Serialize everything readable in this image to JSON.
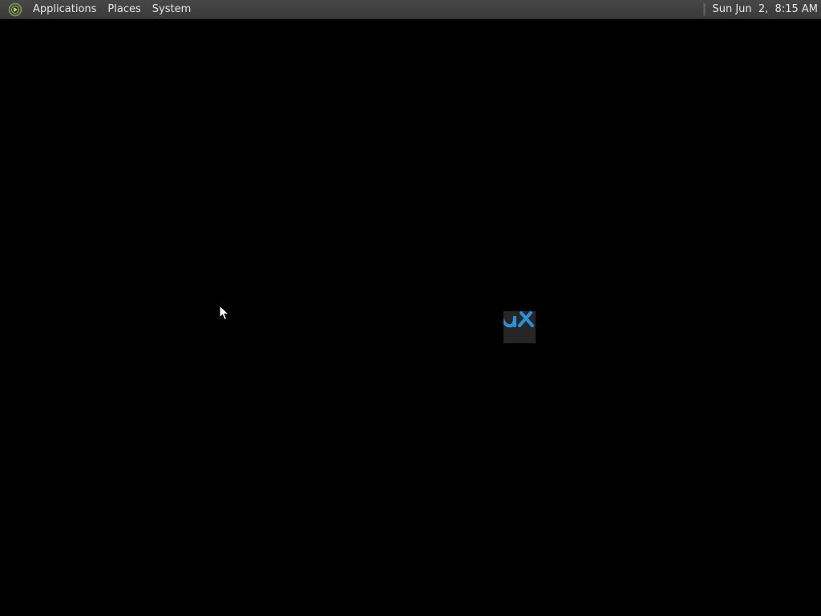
{
  "panel": {
    "logo_icon": "distro-logo-icon",
    "menus": [
      {
        "label": "Applications"
      },
      {
        "label": "Places"
      },
      {
        "label": "System"
      }
    ],
    "clock": "Sun Jun  2,  8:15 AM"
  },
  "desktop": {
    "background_color": "#000000",
    "loading_tile_accent": "#2b90d9"
  }
}
